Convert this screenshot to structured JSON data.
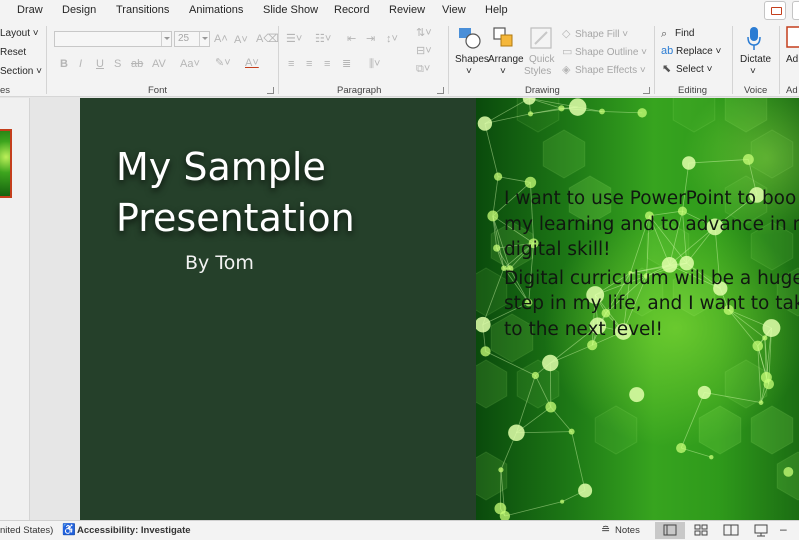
{
  "ribbon": {
    "tabs": [
      "Draw",
      "Design",
      "Transitions",
      "Animations",
      "Slide Show",
      "Record",
      "Review",
      "View",
      "Help"
    ],
    "slides_group": {
      "layout": "Layout",
      "reset": "Reset",
      "section": "Section",
      "label": "es"
    },
    "font_group": {
      "size": "25",
      "label": "Font"
    },
    "paragraph_group": {
      "label": "Paragraph"
    },
    "drawing_group": {
      "shapes": "Shapes",
      "arrange": "Arrange",
      "quick": "Quick",
      "styles": "Styles",
      "shape_fill": "Shape Fill",
      "shape_outline": "Shape Outline",
      "shape_effects": "Shape Effects",
      "label": "Drawing"
    },
    "editing_group": {
      "find": "Find",
      "replace": "Replace",
      "select": "Select",
      "label": "Editing"
    },
    "voice_group": {
      "dictate": "Dictate",
      "label": "Voice"
    },
    "addins_group": {
      "button": "Ad",
      "label": "Ad"
    }
  },
  "slide": {
    "title": "My Sample\nPresentation",
    "byline": "By Tom",
    "body_paragraphs": [
      "I want to use PowerPoint to boo\nmy learning and to advance in n\ndigital skill!",
      "Digital curriculum will be a huge\nstep in my life,  and I want to tak\nto the next level!"
    ]
  },
  "status_bar": {
    "language": "nited States)",
    "accessibility": "Accessibility: Investigate",
    "notes": "Notes"
  },
  "colors": {
    "ribbon_bg": "#f3f3f3",
    "slide_dark": "#25402a",
    "accent": "#c43e1c",
    "accent_blue": "#2b7cd3"
  }
}
